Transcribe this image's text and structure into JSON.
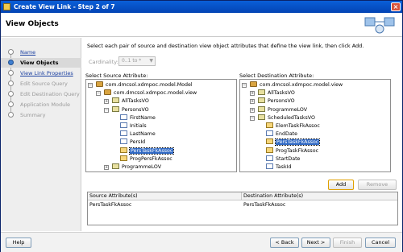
{
  "window": {
    "title": "Create View Link - Step 2 of 7"
  },
  "header": {
    "title": "View Objects"
  },
  "steps": [
    {
      "label": "Name",
      "state": "link"
    },
    {
      "label": "View Objects",
      "state": "current"
    },
    {
      "label": "View Link Properties",
      "state": "link"
    },
    {
      "label": "Edit Source Query",
      "state": "disabled"
    },
    {
      "label": "Edit Destination Query",
      "state": "disabled"
    },
    {
      "label": "Application Module",
      "state": "disabled"
    },
    {
      "label": "Summary",
      "state": "disabled"
    }
  ],
  "main": {
    "instruction": "Select each pair of source and destination view object attributes that define the view link, then click Add.",
    "cardinality_label": "Cardinality:",
    "cardinality_value": "0..1 to *",
    "source_label": "Select Source Attribute:",
    "destination_label": "Select Destination Attribute:"
  },
  "source_tree": [
    {
      "label": "com.dmcsol.xdmpoc.model.Model",
      "level": 0,
      "icon": "pkg",
      "exp": "-"
    },
    {
      "label": "com.dmcsol.xdmpoc.model.view",
      "level": 1,
      "icon": "pkg",
      "exp": "-"
    },
    {
      "label": "AllTasksVO",
      "level": 2,
      "icon": "vo",
      "exp": "+"
    },
    {
      "label": "PersonsVO",
      "level": 2,
      "icon": "vo",
      "exp": "-"
    },
    {
      "label": "FirstName",
      "level": 3,
      "icon": "attr"
    },
    {
      "label": "Initials",
      "level": 3,
      "icon": "attr"
    },
    {
      "label": "LastName",
      "level": 3,
      "icon": "attr"
    },
    {
      "label": "PersId",
      "level": 3,
      "icon": "attr"
    },
    {
      "label": "PersTaskFkAssoc",
      "level": 3,
      "icon": "assoc",
      "selected": true
    },
    {
      "label": "ProgPersFkAssoc",
      "level": 3,
      "icon": "assoc"
    },
    {
      "label": "ProgrammeLOV",
      "level": 2,
      "icon": "vo",
      "exp": "+"
    }
  ],
  "destination_tree": [
    {
      "label": "com.dmcsol.xdmpoc.model.view",
      "level": 0,
      "icon": "pkg",
      "exp": "-"
    },
    {
      "label": "AllTasksVO",
      "level": 1,
      "icon": "vo",
      "exp": "+"
    },
    {
      "label": "PersonsVO",
      "level": 1,
      "icon": "vo",
      "exp": "+"
    },
    {
      "label": "ProgrammeLOV",
      "level": 1,
      "icon": "vo",
      "exp": "+"
    },
    {
      "label": "ScheduledTasksVO",
      "level": 1,
      "icon": "vo",
      "exp": "-"
    },
    {
      "label": "ElemTaskFkAssoc",
      "level": 2,
      "icon": "assoc"
    },
    {
      "label": "EndDate",
      "level": 2,
      "icon": "attr"
    },
    {
      "label": "PersTaskFkAssoc",
      "level": 2,
      "icon": "assoc",
      "selected": true
    },
    {
      "label": "ProgTaskFkAssoc",
      "level": 2,
      "icon": "assoc"
    },
    {
      "label": "StartDate",
      "level": 2,
      "icon": "attr"
    },
    {
      "label": "TaskId",
      "level": 2,
      "icon": "attr"
    }
  ],
  "buttons": {
    "add": "Add",
    "remove": "Remove",
    "help": "Help",
    "back": "< Back",
    "next": "Next >",
    "finish": "Finish",
    "cancel": "Cancel"
  },
  "table": {
    "columns": [
      "Source Attribute(s)",
      "Destination Attribute(s)"
    ],
    "rows": [
      [
        "PersTaskFkAssoc",
        "PersTaskFkAssoc"
      ]
    ]
  },
  "colors": {
    "selection": "#316ac5",
    "titlebar": "#0a5fd8",
    "link": "#1a3fa0"
  }
}
